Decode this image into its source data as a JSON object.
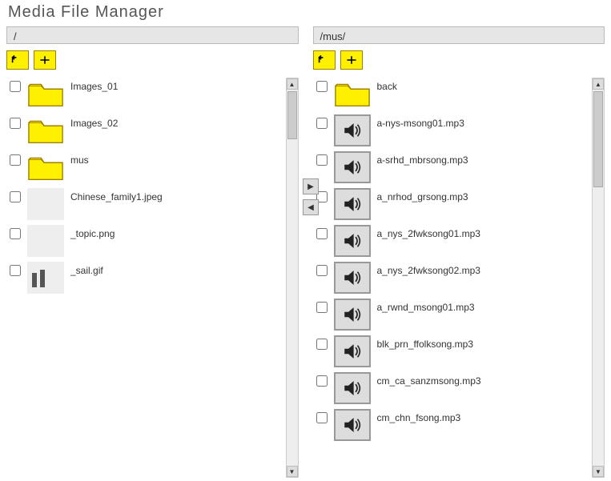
{
  "title": "Media File Manager",
  "left": {
    "path": "/",
    "items": [
      {
        "type": "folder",
        "name": "Images_01"
      },
      {
        "type": "folder",
        "name": "Images_02"
      },
      {
        "type": "folder",
        "name": "mus"
      },
      {
        "type": "image",
        "name": "Chinese_family1.jpeg",
        "ph": "ph1"
      },
      {
        "type": "image",
        "name": "_topic.png",
        "ph": "ph2"
      },
      {
        "type": "image",
        "name": "_sail.gif",
        "ph": "ph3"
      }
    ]
  },
  "right": {
    "path": "/mus/",
    "items": [
      {
        "type": "folder",
        "name": "back"
      },
      {
        "type": "audio",
        "name": "a-nys-msong01.mp3"
      },
      {
        "type": "audio",
        "name": "a-srhd_mbrsong.mp3"
      },
      {
        "type": "audio",
        "name": "a_nrhod_grsong.mp3"
      },
      {
        "type": "audio",
        "name": "a_nys_2fwksong01.mp3"
      },
      {
        "type": "audio",
        "name": "a_nys_2fwksong02.mp3"
      },
      {
        "type": "audio",
        "name": "a_rwnd_msong01.mp3"
      },
      {
        "type": "audio",
        "name": "blk_prn_ffolksong.mp3"
      },
      {
        "type": "audio",
        "name": "cm_ca_sanzmsong.mp3"
      },
      {
        "type": "audio",
        "name": "cm_chn_fsong.mp3"
      }
    ]
  },
  "icons": {
    "up": "up-arrow",
    "add": "plus",
    "move_right": "▶",
    "move_left": "◀"
  }
}
